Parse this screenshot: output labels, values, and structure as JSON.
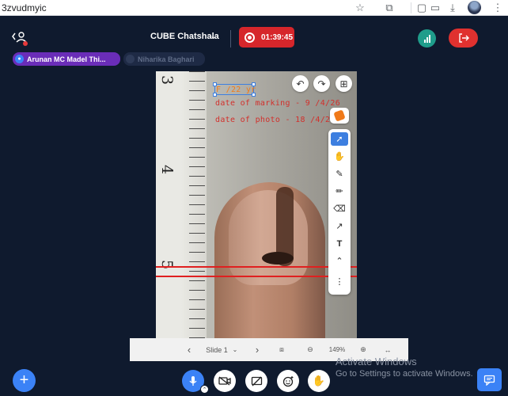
{
  "browser": {
    "url": "3zvudmyic",
    "icons": [
      "star-icon",
      "extension-icon",
      "bookmark-sidebar-icon",
      "cast-icon",
      "download-icon",
      "profile-avatar",
      "menu-icon"
    ]
  },
  "header": {
    "room_title": "CUBE Chatshala",
    "recording_time": "01:39:45"
  },
  "participants": [
    {
      "name": "Arunan MC Madel Thi...",
      "mic": "on"
    },
    {
      "name": "Niharika Baghari",
      "mic": "muted"
    }
  ],
  "slide": {
    "annotations": [
      "F /22 yr",
      "date of marking - 9 /4/26",
      "date of photo - 18 /4/26"
    ],
    "ruler_numbers": [
      "3",
      "4",
      "5"
    ]
  },
  "tools": [
    "select",
    "pan",
    "marker",
    "pen",
    "eraser",
    "arrow",
    "text",
    "collapse",
    "more"
  ],
  "slide_nav": {
    "label": "Slide 1",
    "zoom": "149%"
  },
  "watermark": {
    "line1": "Activate Windows",
    "line2": "Go to Settings to activate Windows."
  },
  "colors": {
    "background": "#0f1a2e",
    "record": "#d6262b",
    "accent": "#3b82f6",
    "participant_active": "#6a2db8",
    "annotation": "#d2302c"
  }
}
